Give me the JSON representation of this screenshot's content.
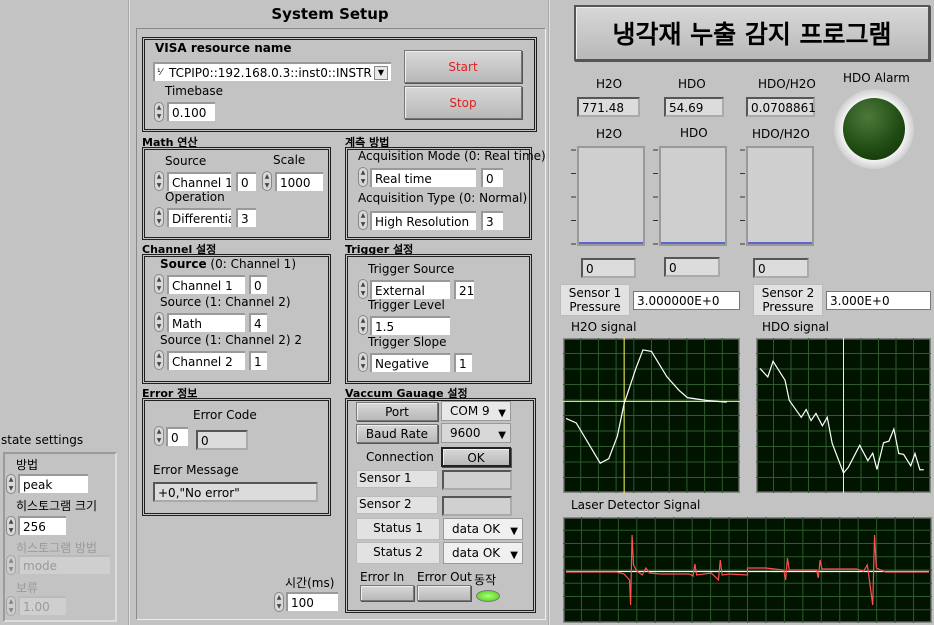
{
  "title": "System Setup",
  "app_title": "냉각재 누출 감지 프로그램",
  "visa": {
    "label": "VISA resource name",
    "value": "TCPIP0::192.168.0.3::inst0::INSTR",
    "icon": "visa-io-icon",
    "timebase_label": "Timebase",
    "timebase": "0.100",
    "start": "Start",
    "stop": "Stop",
    "button_text_color": "#e02020"
  },
  "math": {
    "group": "Math 연산",
    "source_label": "Source",
    "source": "Channel 1",
    "source_num": "0",
    "scale_label": "Scale",
    "scale": "1000",
    "operation_label": "Operation",
    "operation": "Differentia",
    "operation_num": "3"
  },
  "acq": {
    "group": "계측 방법",
    "mode_label": "Acquisition Mode (0: Real time)",
    "mode": "Real time",
    "mode_num": "0",
    "type_label": "Acquisition Type (0: Normal)",
    "type": "High Resolution",
    "type_num": "3"
  },
  "channel": {
    "group": "Channel 설정",
    "src0_bold": "Source",
    "src0_rest": " (0: Channel 1)",
    "src0": "Channel 1",
    "src0_num": "0",
    "src1_label": "Source (1: Channel 2)",
    "src1": "Math",
    "src1_num": "4",
    "src2_label": "Source (1: Channel 2) 2",
    "src2": "Channel 2",
    "src2_num": "1"
  },
  "trigger": {
    "group": "Trigger 설정",
    "source_label": "Trigger Source",
    "source": "External",
    "source_num": "21",
    "level_label": "Trigger Level",
    "level": "1.5",
    "slope_label": "Trigger Slope",
    "slope": "Negative",
    "slope_num": "1"
  },
  "error": {
    "group": "Error 정보",
    "code_label": "Error Code",
    "code_in": "0",
    "code": "0",
    "msg_label": "Error Message",
    "msg": "+0,\"No error\""
  },
  "vacuum": {
    "group": "Vaccum Gauage 설정",
    "port_label": "Port",
    "port": "COM 9",
    "baud_label": "Baud Rate",
    "baud": "9600",
    "conn_label": "Connection",
    "conn": "OK",
    "sensor1": "Sensor 1",
    "sensor2": "Sensor 2",
    "status1_label": "Status 1",
    "status1": "data OK",
    "status2_label": "Status 2",
    "status2": "data OK",
    "err_in": "Error In",
    "err_out": "Error Out",
    "run_label": "동작",
    "run_led": "#55dd22"
  },
  "time": {
    "label": "시간(ms)",
    "value": "100"
  },
  "state": {
    "title": "state settings",
    "method_label": "방법",
    "method": "peak",
    "hist_size_label": "히스토그램 크기",
    "hist_size": "256",
    "hist_method_label": "히스토그램 방법",
    "hist_method": "mode",
    "hold_label": "보류",
    "hold": "1.00"
  },
  "readouts": {
    "h2o_label": "H2O",
    "h2o": "771.48",
    "hdo_label": "HDO",
    "hdo": "54.69",
    "ratio_label": "HDO/H2O",
    "ratio": "0.0708861",
    "alarm_label": "HDO Alarm",
    "alarm_color": "#1e4a12"
  },
  "meters": {
    "h2o_label": "H2O",
    "hdo_label": "HDO",
    "ratio_label": "HDO/H2O",
    "h2o": "0",
    "hdo": "0",
    "ratio": "0"
  },
  "pressure": {
    "s1_label_1": "Sensor 1",
    "s1_label_2": "Pressure",
    "s1": "3.000000E+0",
    "s2_label_1": "Sensor 2",
    "s2_label_2": "Pressure",
    "s2": "3.000E+0"
  },
  "chart_data": [
    {
      "type": "line",
      "title": "H2O signal",
      "grid": true,
      "cursor": [
        34,
        59.5
      ],
      "series": [
        {
          "color": "#ffffff",
          "points": [
            [
              0,
              48
            ],
            [
              6,
              45
            ],
            [
              20,
              18
            ],
            [
              25,
              21
            ],
            [
              30,
              36
            ],
            [
              34,
              58
            ],
            [
              41,
              82
            ],
            [
              45,
              94
            ],
            [
              50,
              93
            ],
            [
              59,
              76
            ],
            [
              66,
              67
            ],
            [
              71,
              62
            ],
            [
              83,
              60
            ],
            [
              94,
              59
            ]
          ]
        }
      ]
    },
    {
      "type": "line",
      "title": "HDO signal",
      "grid": true,
      "cursor_x": 50,
      "series": [
        {
          "color": "#ffffff",
          "points": [
            [
              0.6,
              81.6
            ],
            [
              5.2,
              75.9
            ],
            [
              8.3,
              86.4
            ],
            [
              15.4,
              73.7
            ],
            [
              17.9,
              60.2
            ],
            [
              25,
              48.8
            ],
            [
              27.9,
              54
            ],
            [
              30.8,
              46.6
            ],
            [
              33.7,
              51.4
            ],
            [
              37.5,
              43.1
            ],
            [
              40.4,
              48.8
            ],
            [
              43.3,
              31.3
            ],
            [
              50,
              11.4
            ],
            [
              52.9,
              15.3
            ],
            [
              59.6,
              30
            ],
            [
              64.4,
              19.7
            ],
            [
              67.3,
              24.7
            ],
            [
              69.8,
              13.8
            ],
            [
              73.7,
              31.7
            ],
            [
              76.9,
              32.8
            ],
            [
              79.8,
              40.9
            ],
            [
              82.7,
              24.5
            ],
            [
              85.6,
              23.9
            ],
            [
              89.8,
              16.2
            ],
            [
              92.3,
              24.5
            ],
            [
              95.2,
              13.6
            ],
            [
              97.5,
              13.6
            ]
          ]
        }
      ]
    },
    {
      "type": "line",
      "title": "Laser Detector Signal",
      "grid": true,
      "series": [
        {
          "color": "#ffffff",
          "points": [
            [
              0,
              48.5
            ],
            [
              100,
              48.5
            ]
          ]
        },
        {
          "color": "#ff5050",
          "points": [
            [
              0,
              48
            ],
            [
              14,
              48
            ],
            [
              16,
              46
            ],
            [
              17.5,
              40
            ],
            [
              17.8,
              15
            ],
            [
              18.2,
              85
            ],
            [
              18.6,
              55
            ],
            [
              19.5,
              49
            ],
            [
              21,
              45
            ],
            [
              22,
              52
            ],
            [
              23,
              47
            ],
            [
              26,
              46
            ],
            [
              34,
              46
            ],
            [
              35,
              44
            ],
            [
              35.5,
              56
            ],
            [
              36,
              45
            ],
            [
              40,
              47
            ],
            [
              42,
              40
            ],
            [
              42.5,
              60
            ],
            [
              43,
              45
            ],
            [
              45,
              46
            ],
            [
              50,
              45
            ],
            [
              50,
              52
            ],
            [
              55,
              52
            ],
            [
              60,
              50
            ],
            [
              60.5,
              40
            ],
            [
              61,
              62
            ],
            [
              61.5,
              50
            ],
            [
              65,
              50
            ],
            [
              69,
              50
            ],
            [
              69.5,
              42
            ],
            [
              70,
              60
            ],
            [
              70.5,
              51
            ],
            [
              75,
              51
            ],
            [
              80,
              51
            ],
            [
              82,
              49
            ],
            [
              83,
              55
            ],
            [
              83.5,
              42
            ],
            [
              84.5,
              15
            ],
            [
              85,
              85
            ],
            [
              85.5,
              52
            ],
            [
              88,
              48
            ],
            [
              100,
              48
            ]
          ]
        }
      ]
    }
  ]
}
